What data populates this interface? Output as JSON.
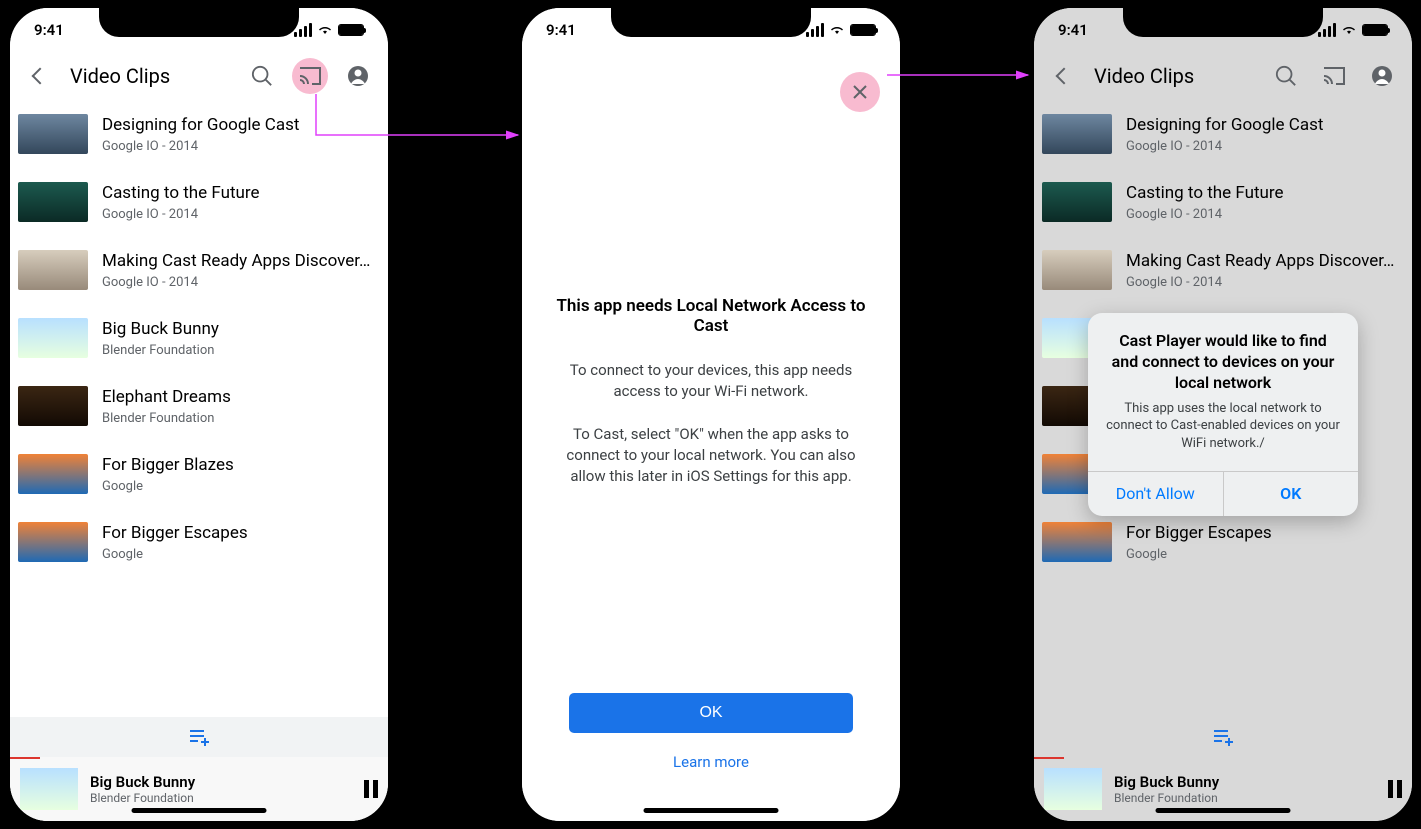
{
  "status": {
    "time": "9:41"
  },
  "header": {
    "title": "Video Clips"
  },
  "videos": [
    {
      "title": "Designing for Google Cast",
      "sub": "Google IO - 2014",
      "thumb": "t1"
    },
    {
      "title": "Casting to the Future",
      "sub": "Google IO - 2014",
      "thumb": "t2"
    },
    {
      "title": "Making Cast Ready Apps Discover…",
      "sub": "Google IO - 2014",
      "thumb": "t3"
    },
    {
      "title": "Big Buck Bunny",
      "sub": "Blender Foundation",
      "thumb": "t4"
    },
    {
      "title": "Elephant Dreams",
      "sub": "Blender Foundation",
      "thumb": "t5"
    },
    {
      "title": "For Bigger Blazes",
      "sub": "Google",
      "thumb": "t6"
    },
    {
      "title": "For Bigger Escapes",
      "sub": "Google",
      "thumb": "t7"
    }
  ],
  "now_playing": {
    "title": "Big Buck Bunny",
    "sub": "Blender Foundation",
    "progress_pct": 8
  },
  "interstitial": {
    "heading": "This app needs Local Network Access to Cast",
    "para1": "To connect to your devices, this app needs access to your Wi-Fi network.",
    "para2": "To Cast, select \"OK\" when the app asks to connect to your local network. You can also allow this later in iOS Settings for this app.",
    "ok": "OK",
    "learn_more": "Learn more"
  },
  "alert": {
    "title": "Cast Player would like to find and connect to devices on your local network",
    "message": "This app uses the local network to connect to Cast-enabled devices on your WiFi network./",
    "deny": "Don't Allow",
    "allow": "OK"
  },
  "colors": {
    "accent_pink": "#f8bbd0",
    "primary_blue": "#1a73e8",
    "ios_blue": "#007aff",
    "arrow": "#e040fb"
  }
}
